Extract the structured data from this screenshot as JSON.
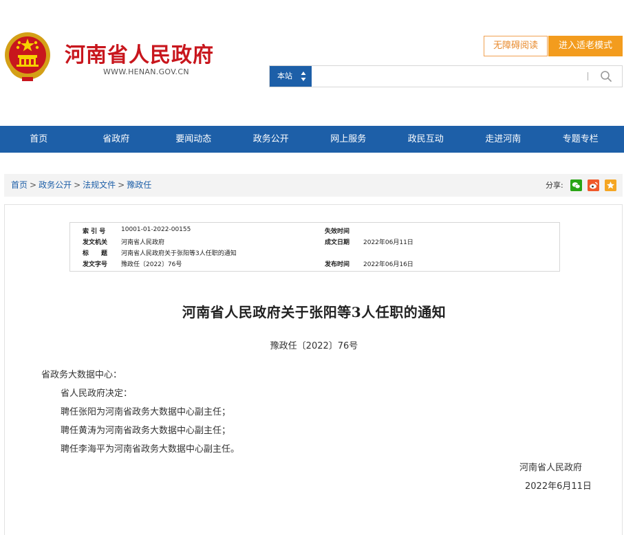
{
  "header": {
    "site_title": "河南省人民政府",
    "site_url": "WWW.HENAN.GOV.CN",
    "accessibility_label": "无障碍阅读",
    "elder_mode_label": "进入适老模式",
    "search_scope": "本站",
    "search_placeholder": "",
    "search_separator": "|"
  },
  "nav": {
    "items": [
      "首页",
      "省政府",
      "要闻动态",
      "政务公开",
      "网上服务",
      "政民互动",
      "走进河南",
      "专题专栏"
    ]
  },
  "breadcrumb": {
    "items": [
      "首页",
      "政务公开",
      "法规文件",
      "豫政任"
    ],
    "separator": ">",
    "share_label": "分享:"
  },
  "meta": {
    "index_no_label": "索 引 号",
    "index_no": "10001-01-2022-00155",
    "expiry_label": "失效时间",
    "expiry": "",
    "issuer_label": "发文机关",
    "issuer": "河南省人民政府",
    "written_date_label": "成文日期",
    "written_date": "2022年06月11日",
    "subject_label": "标　　题",
    "subject": "河南省人民政府关于张阳等3人任职的通知",
    "doc_no_label": "发文字号",
    "doc_no": "豫政任〔2022〕76号",
    "publish_date_label": "发布时间",
    "publish_date": "2022年06月16日"
  },
  "document": {
    "title": "河南省人民政府关于张阳等3人任职的通知",
    "doc_number": "豫政任〔2022〕76号",
    "recipient": "省政务大数据中心：",
    "paragraphs": [
      "省人民政府决定：",
      "聘任张阳为河南省政务大数据中心副主任；",
      "聘任黄涛为河南省政务大数据中心副主任；",
      "聘任李海平为河南省政务大数据中心副主任。"
    ],
    "signature": "河南省人民政府",
    "date": "2022年6月11日"
  },
  "colors": {
    "brand_red": "#c8161d",
    "nav_blue": "#1d5fa8",
    "accent_orange": "#f39c1e"
  },
  "icons": {
    "emblem": "national-emblem-icon",
    "search": "search-icon",
    "wechat": "wechat-icon",
    "weibo": "weibo-icon",
    "favorite": "star-icon"
  }
}
